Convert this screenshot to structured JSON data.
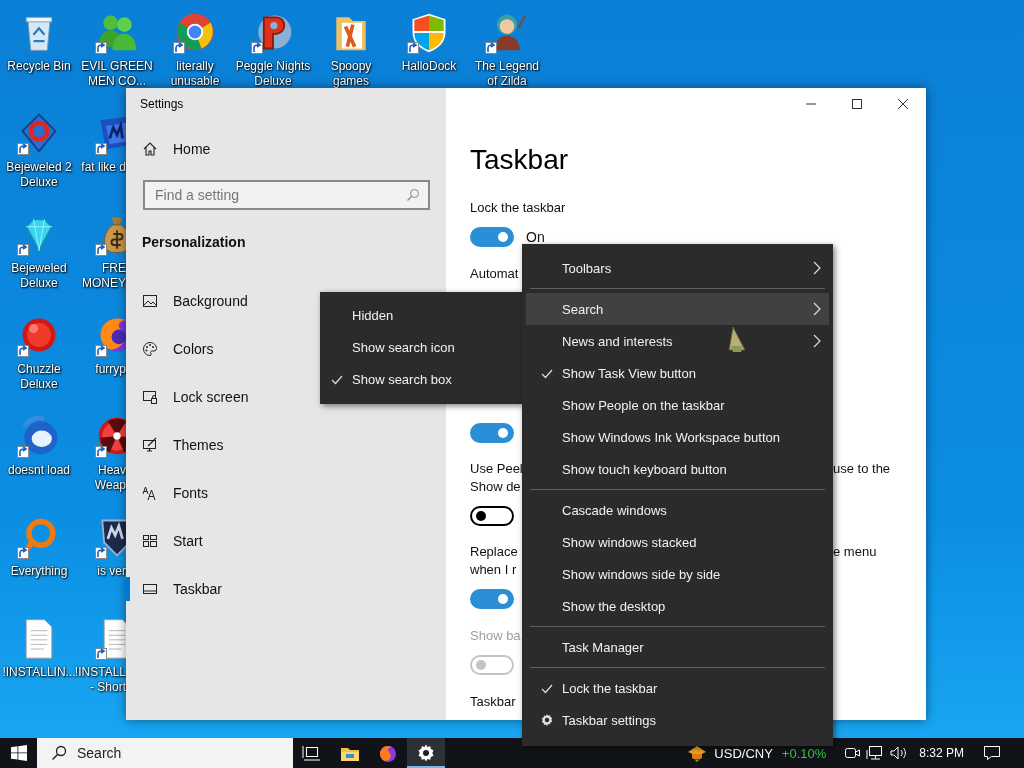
{
  "desktop_icons": [
    {
      "label": "Recycle Bin",
      "shortcut": false
    },
    {
      "label": "Bejeweled 2\nDeluxe",
      "shortcut": true
    },
    {
      "label": "Bejeweled\nDeluxe",
      "shortcut": true
    },
    {
      "label": "Chuzzle\nDeluxe",
      "shortcut": true
    },
    {
      "label": "doesnt load",
      "shortcut": true
    },
    {
      "label": "Everything",
      "shortcut": true
    },
    {
      "label": "!INSTALLIN...",
      "shortcut": false
    },
    {
      "label": "EVIL GREEN\nMEN CO...",
      "shortcut": true
    },
    {
      "label": "fat like d",
      "shortcut": true
    },
    {
      "label": "FRE\nMONEY",
      "shortcut": true
    },
    {
      "label": "furryp",
      "shortcut": true
    },
    {
      "label": "Heav\nWeap",
      "shortcut": true
    },
    {
      "label": "is ver",
      "shortcut": true
    },
    {
      "label": "!INSTALL\n- Short",
      "shortcut": true
    },
    {
      "label": "literally\nunusable",
      "shortcut": true
    },
    {
      "label": "Peggle Nights\nDeluxe",
      "shortcut": true
    },
    {
      "label": "Spoopy\ngames",
      "shortcut": false
    },
    {
      "label": "HalloDock",
      "shortcut": true
    },
    {
      "label": "The Legend\nof Zilda",
      "shortcut": true
    }
  ],
  "settings_window": {
    "title": "Settings",
    "home": "Home",
    "search": {
      "placeholder": "Find a setting"
    },
    "section": "Personalization",
    "nav_items": [
      {
        "label": "Background",
        "selected": false
      },
      {
        "label": "Colors",
        "selected": false
      },
      {
        "label": "Lock screen",
        "selected": false
      },
      {
        "label": "Themes",
        "selected": false
      },
      {
        "label": "Fonts",
        "selected": false
      },
      {
        "label": "Start",
        "selected": false
      },
      {
        "label": "Taskbar",
        "selected": true
      }
    ],
    "page_title": "Taskbar",
    "settings": [
      {
        "kind": "label",
        "text": "Lock the taskbar",
        "disabled": false
      },
      {
        "kind": "toggle",
        "on": true,
        "disabled": false,
        "state_text": "On"
      },
      {
        "kind": "label",
        "text": "Automat",
        "disabled": false
      },
      {
        "kind": "toggle",
        "on": true,
        "disabled": false
      },
      {
        "kind": "label",
        "text": "Use Peel\nShow de",
        "right_text": "use to the",
        "disabled": false
      },
      {
        "kind": "toggle",
        "on": false,
        "disabled": false
      },
      {
        "kind": "label",
        "text": "Replace\nwhen I r",
        "right_text": "e menu",
        "disabled": false
      },
      {
        "kind": "toggle",
        "on": true,
        "disabled": false
      },
      {
        "kind": "label",
        "text": "Show ba",
        "disabled": true
      },
      {
        "kind": "toggle",
        "on": false,
        "disabled": true
      },
      {
        "kind": "label",
        "text": "Taskbar",
        "disabled": false
      }
    ]
  },
  "context_menu": {
    "items": [
      {
        "kind": "item",
        "label": "Toolbars",
        "checked": false,
        "submenu": true,
        "selected": false
      },
      {
        "kind": "separator"
      },
      {
        "kind": "item",
        "label": "Search",
        "checked": false,
        "submenu": true,
        "selected": true
      },
      {
        "kind": "item",
        "label": "News and interests",
        "checked": false,
        "submenu": true,
        "selected": false
      },
      {
        "kind": "item",
        "label": "Show Task View button",
        "checked": true,
        "submenu": false,
        "selected": false
      },
      {
        "kind": "item",
        "label": "Show People on the taskbar",
        "checked": false,
        "submenu": false,
        "selected": false
      },
      {
        "kind": "item",
        "label": "Show Windows Ink Workspace button",
        "checked": false,
        "submenu": false,
        "selected": false
      },
      {
        "kind": "item",
        "label": "Show touch keyboard button",
        "checked": false,
        "submenu": false,
        "selected": false
      },
      {
        "kind": "separator"
      },
      {
        "kind": "item",
        "label": "Cascade windows",
        "checked": false,
        "submenu": false,
        "selected": false
      },
      {
        "kind": "item",
        "label": "Show windows stacked",
        "checked": false,
        "submenu": false,
        "selected": false
      },
      {
        "kind": "item",
        "label": "Show windows side by side",
        "checked": false,
        "submenu": false,
        "selected": false
      },
      {
        "kind": "item",
        "label": "Show the desktop",
        "checked": false,
        "submenu": false,
        "selected": false
      },
      {
        "kind": "separator"
      },
      {
        "kind": "item",
        "label": "Task Manager",
        "checked": false,
        "submenu": false,
        "selected": false
      },
      {
        "kind": "separator"
      },
      {
        "kind": "item",
        "label": "Lock the taskbar",
        "checked": true,
        "submenu": false,
        "selected": false
      },
      {
        "kind": "icon_item",
        "label": "Taskbar settings",
        "checked": false,
        "submenu": false,
        "selected": false
      }
    ]
  },
  "search_submenu": {
    "items": [
      {
        "label": "Hidden",
        "checked": false
      },
      {
        "label": "Show search icon",
        "checked": false
      },
      {
        "label": "Show search box",
        "checked": true
      }
    ]
  },
  "taskbar": {
    "search": {
      "placeholder": "Search"
    },
    "apps": [
      {
        "active": false
      },
      {
        "active": false
      },
      {
        "active": false
      },
      {
        "active": true
      }
    ],
    "ticker": {
      "symbol": "USD/CNY",
      "change": "+0.10%"
    },
    "clock": "8:32 PM"
  }
}
